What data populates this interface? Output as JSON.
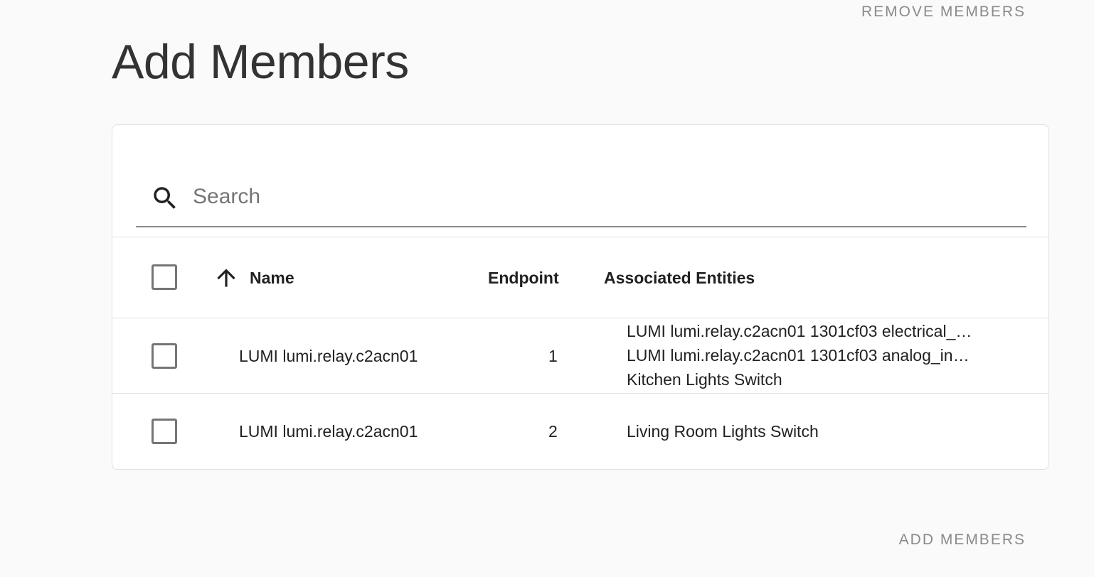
{
  "header": {
    "remove_label": "REMOVE MEMBERS",
    "title": "Add Members"
  },
  "search": {
    "placeholder": "Search",
    "value": ""
  },
  "table": {
    "columns": [
      "Name",
      "Endpoint",
      "Associated Entities"
    ],
    "sort": {
      "column": "Name",
      "direction": "ascending"
    },
    "rows": [
      {
        "name": "LUMI lumi.relay.c2acn01",
        "endpoint": "1",
        "entities": [
          "LUMI lumi.relay.c2acn01 1301cf03 electrical_…",
          "LUMI lumi.relay.c2acn01 1301cf03 analog_in…",
          "Kitchen Lights Switch"
        ]
      },
      {
        "name": "LUMI lumi.relay.c2acn01",
        "endpoint": "2",
        "entities": [
          "Living Room Lights Switch"
        ]
      }
    ]
  },
  "footer": {
    "add_label": "ADD MEMBERS"
  },
  "icons": {
    "search": "search-icon",
    "sort": "arrow-up-icon"
  }
}
